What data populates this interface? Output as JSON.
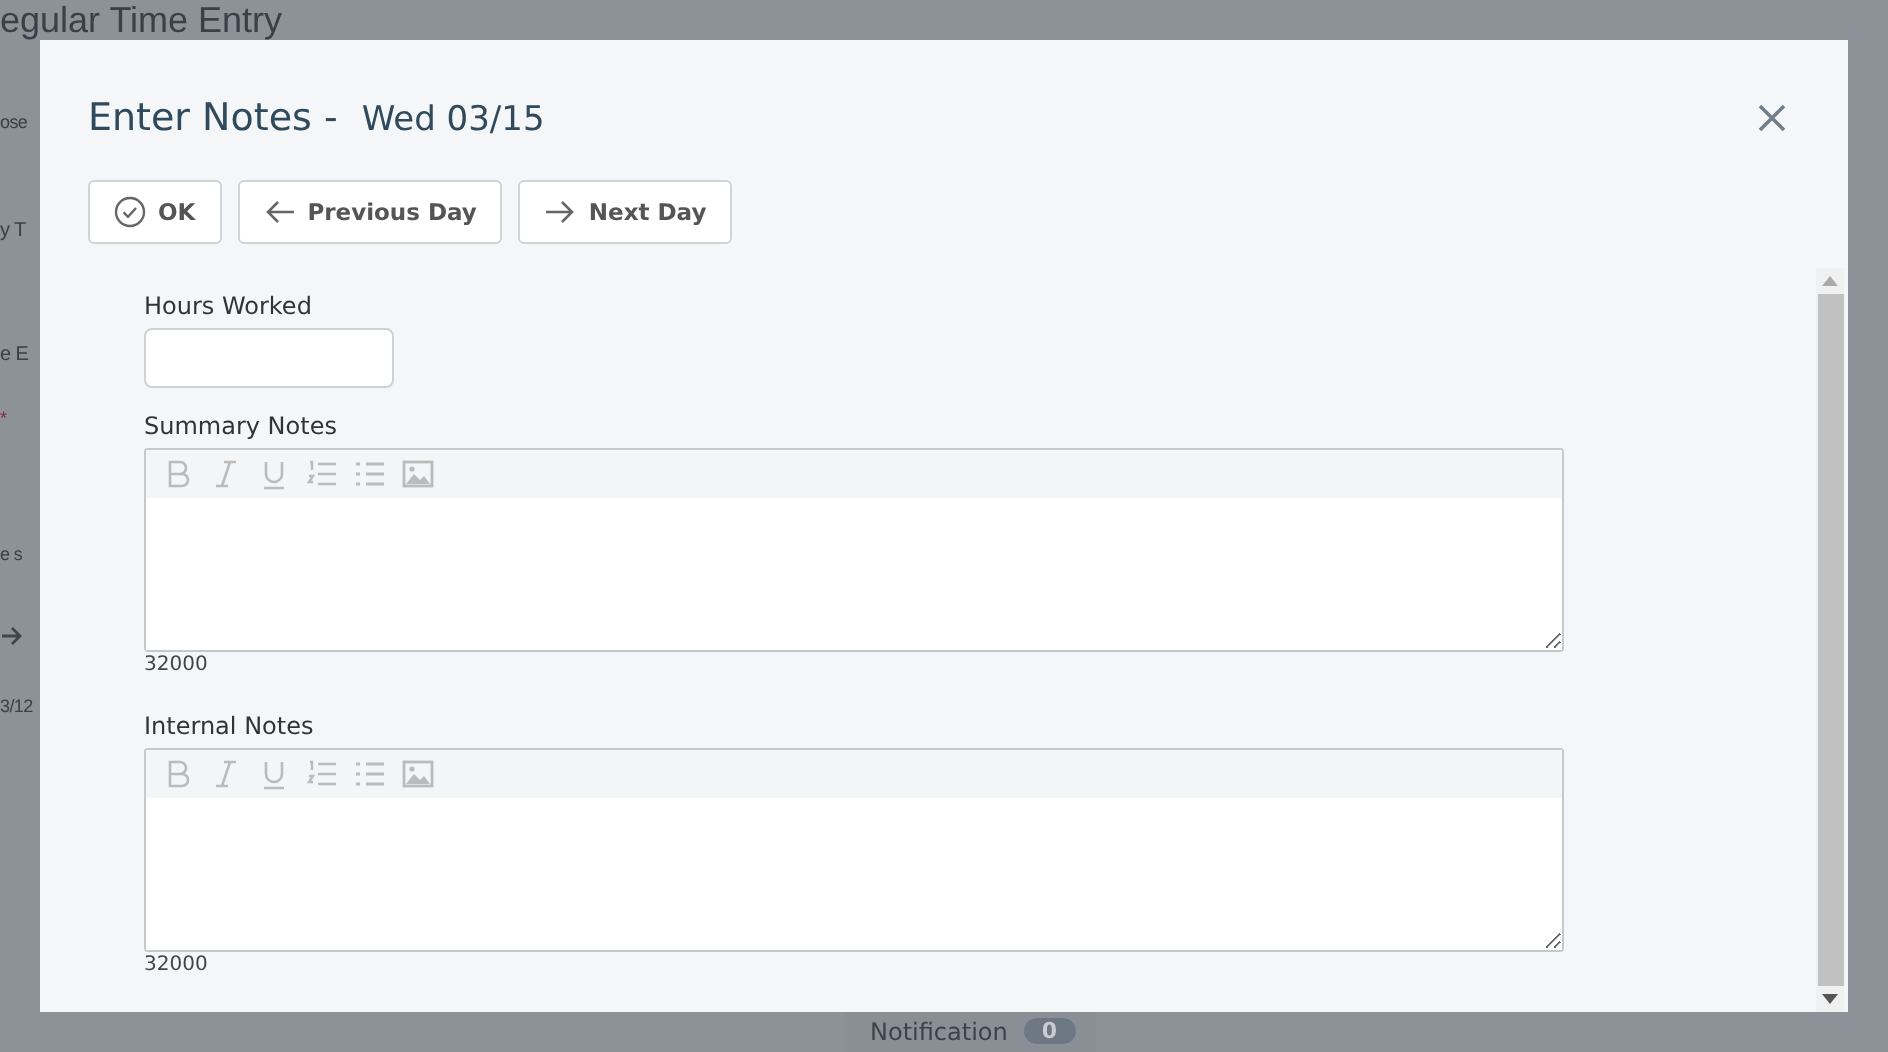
{
  "background": {
    "page_title": "egular Time Entry",
    "fragments": [
      "ose",
      "y T",
      "e E",
      "*",
      "e s",
      "3/12"
    ],
    "notification": {
      "label": "Notification",
      "count": "0"
    }
  },
  "dialog": {
    "title": "Enter Notes -",
    "date": "Wed 03/15",
    "buttons": [
      {
        "kind": "ok",
        "label": "OK"
      },
      {
        "kind": "prev",
        "label": "Previous Day"
      },
      {
        "kind": "next",
        "label": "Next Day"
      }
    ],
    "fields": [
      {
        "kind": "input",
        "label": "Hours Worked"
      },
      {
        "kind": "editor",
        "label": "Summary Notes",
        "counter": "32000"
      },
      {
        "kind": "editor",
        "label": "Internal Notes",
        "counter": "32000"
      }
    ]
  }
}
